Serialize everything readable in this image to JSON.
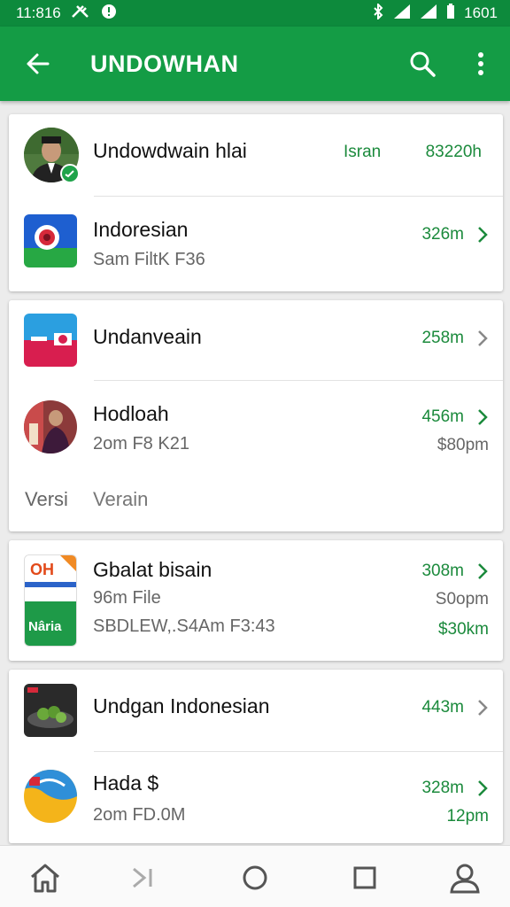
{
  "status_bar": {
    "time": "11:816",
    "right_text": "1601"
  },
  "app_bar": {
    "title": "UNDOWHAN"
  },
  "cards": [
    {
      "items": [
        {
          "name": "Undowdwain hlai",
          "tag": "Isran",
          "meta": "83220h"
        },
        {
          "name": "Indoresian",
          "subtitle": "Sam FiltK F36",
          "meta": "326m"
        }
      ]
    },
    {
      "items": [
        {
          "name": "Undanveain",
          "meta": "258m"
        },
        {
          "name": "Hodloah",
          "subtitle": "2om F8 K21",
          "meta": "456m",
          "meta2": "$80pm"
        }
      ],
      "footer": {
        "label": "Versi",
        "value": "Verain"
      }
    },
    {
      "items": [
        {
          "name": "Gbalat bisain",
          "subtitle": "96m File",
          "subtitle2": "SBDLEW,.S4Am F3:43",
          "meta": "308m",
          "meta2": "S0opm",
          "meta3": "$30km",
          "thumb_top_text": "OH",
          "thumb_bottom_text": "Nâria"
        }
      ]
    },
    {
      "items": [
        {
          "name": "Undgan Indonesian",
          "meta": "443m"
        },
        {
          "name": "Hada $",
          "subtitle": "2om FD.0M",
          "meta": "328m",
          "meta2": "12pm"
        }
      ]
    }
  ],
  "colors": {
    "appbar": "#149c45",
    "statusbar": "#0d8a3c",
    "accent": "#1b8a3c"
  }
}
